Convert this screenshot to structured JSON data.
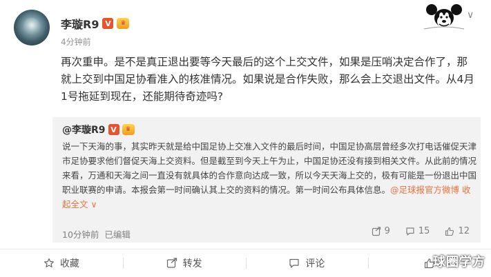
{
  "author": {
    "name": "李璇R9",
    "v_badge": "V",
    "time": "4分钟前"
  },
  "post": {
    "text": "再次重申。是不是真正退出要等今天最后的这个上交文件，如果是压哨决定合作了，那就上交到中国足协看准入的核准情况。如果说是合作失败，那么会上交退出文件。从4月1号拖延到现在，还能期待奇迹吗?"
  },
  "repost": {
    "author": "@李璇R9",
    "v_badge": "V",
    "body": "说一下天海的事，其实昨天就是给中国足协上交准入文件的最后时间，中国足协高层曾经多次打电话催促天津市足协要求他们督促天海上交资料。但是截至到今天上午为止，中国足协还没有接到相关文件。从此前的情况来看，万通和天海之间一直没有就具体的合作意向达成一致，所以今天天海上交的，极有可能是一份退出中国职业联赛的申请。本报会第一时间确认其上交的资料的情况。第一时间公布具体信息。",
    "mention": "@足球报官方微博",
    "collapse": "收起全文 ∨",
    "meta_time": "10分钟前",
    "meta_edited": "已编辑",
    "stats": {
      "reposts": "9",
      "comments": "15",
      "likes": "12"
    }
  },
  "actions": {
    "favorite": "收藏",
    "repost": "转发",
    "comment": "评论"
  },
  "watermark": "球圈学方",
  "colors": {
    "accent": "#eb7340",
    "repost_bg": "#f2f2f2"
  }
}
